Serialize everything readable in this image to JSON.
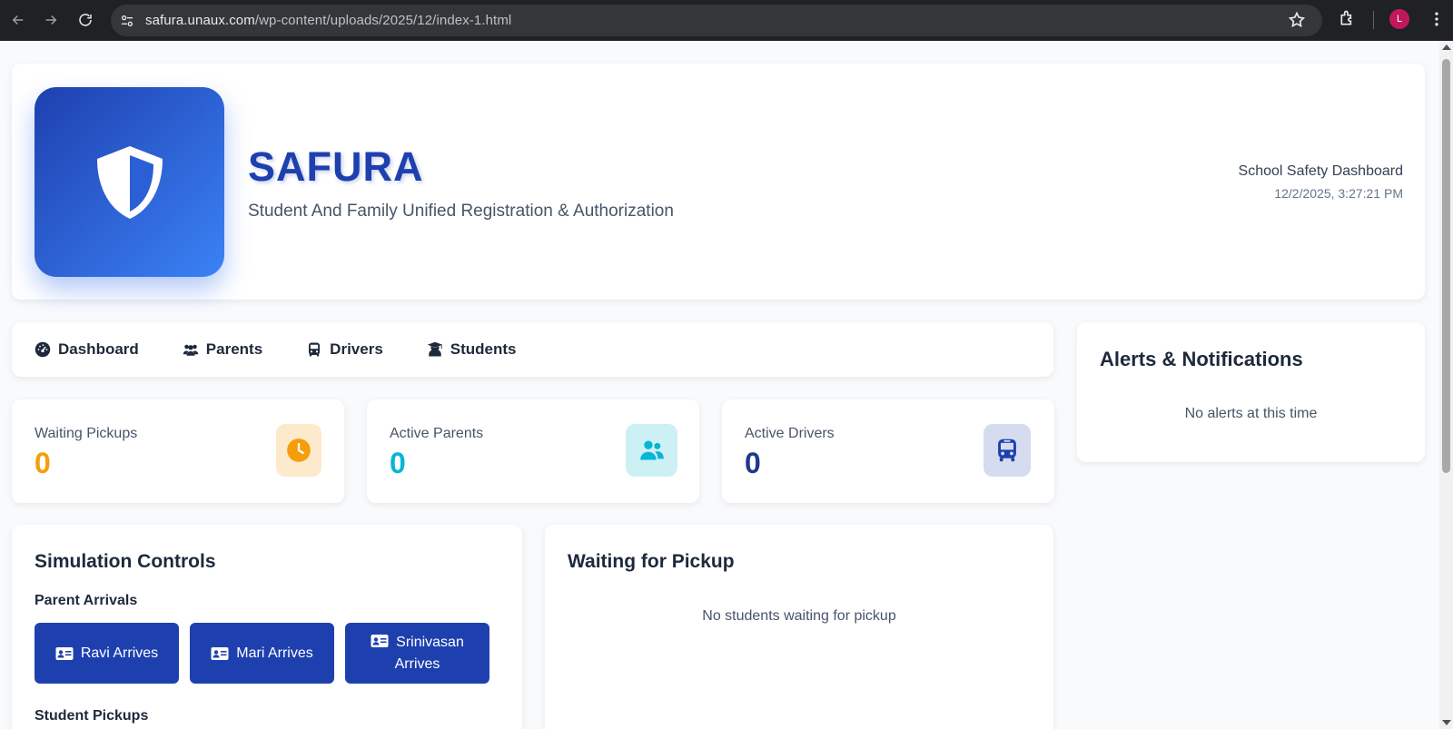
{
  "browser": {
    "url_host": "safura.unaux.com",
    "url_path": "/wp-content/uploads/2025/12/index-1.html",
    "profile_initial": "L"
  },
  "header": {
    "title": "SAFURA",
    "subtitle": "Student And Family Unified Registration & Authorization",
    "dashboard_label": "School Safety Dashboard",
    "datetime": "12/2/2025, 3:27:21 PM",
    "logo_icon": "shield-icon"
  },
  "nav": {
    "items": [
      {
        "label": "Dashboard",
        "icon": "gauge-icon"
      },
      {
        "label": "Parents",
        "icon": "users-icon"
      },
      {
        "label": "Drivers",
        "icon": "bus-icon"
      },
      {
        "label": "Students",
        "icon": "graduate-icon"
      }
    ]
  },
  "alerts": {
    "title": "Alerts & Notifications",
    "empty_text": "No alerts at this time"
  },
  "stats": [
    {
      "label": "Waiting Pickups",
      "value": "0",
      "icon": "clock-icon",
      "color": "#f59e0b",
      "icon_bg": "#fde9cc"
    },
    {
      "label": "Active Parents",
      "value": "0",
      "icon": "users-icon",
      "color": "#06b6d4",
      "icon_bg": "#cdf0f5"
    },
    {
      "label": "Active Drivers",
      "value": "0",
      "icon": "bus-icon",
      "color": "#1e3a8a",
      "icon_bg": "#d5dcf0"
    }
  ],
  "simulation": {
    "title": "Simulation Controls",
    "parent_arrivals_label": "Parent Arrivals",
    "buttons": [
      {
        "label": "Ravi Arrives",
        "icon": "id-card-icon"
      },
      {
        "label": "Mari Arrives",
        "icon": "id-card-icon"
      },
      {
        "label": "Srinivasan Arrives",
        "icon": "id-card-icon"
      }
    ],
    "student_pickups_label": "Student Pickups"
  },
  "waiting": {
    "title": "Waiting for Pickup",
    "empty_text": "No students waiting for pickup"
  },
  "colors": {
    "brand": "#1e40af",
    "brand_light": "#3b82f6"
  }
}
